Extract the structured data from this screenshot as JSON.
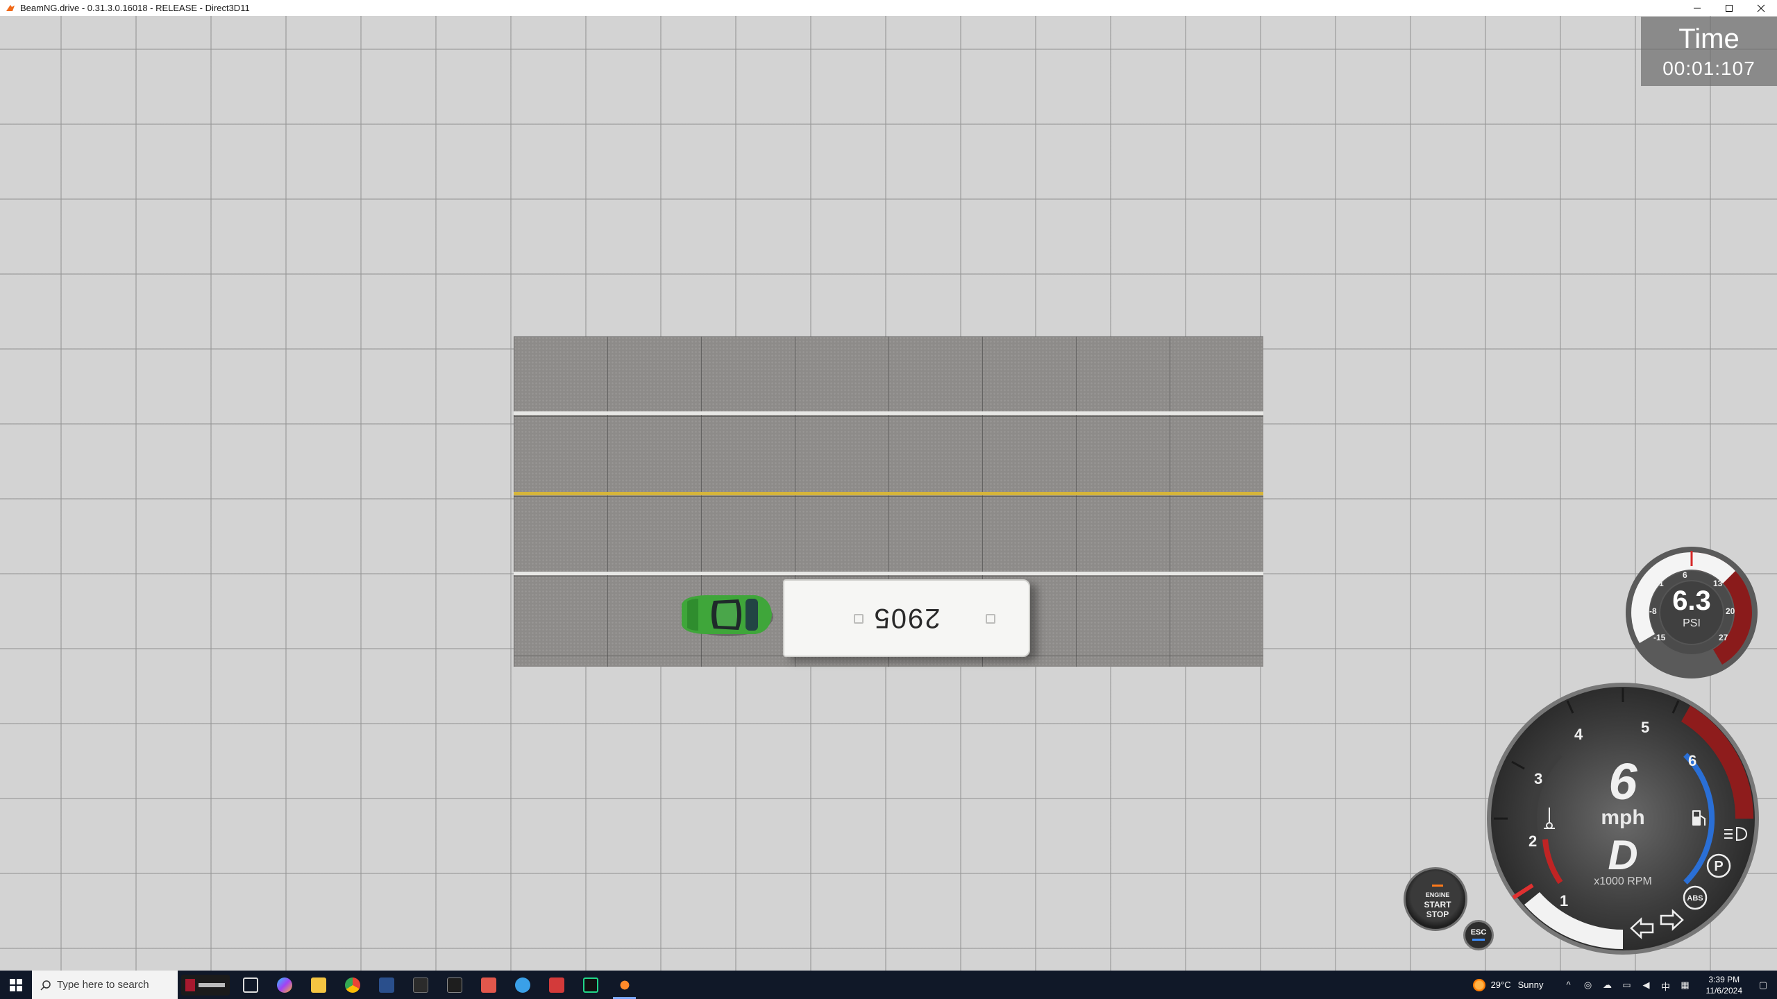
{
  "window": {
    "title": "BeamNG.drive - 0.31.3.0.16018 - RELEASE - Direct3D11",
    "controls": [
      "minimize-icon",
      "maximize-icon",
      "close-icon"
    ]
  },
  "scene": {
    "bus_number": "2905",
    "ground_color": "#d3d3d3",
    "road_color": "#8d8b89",
    "lane_line_white": "#e7e7e5",
    "lane_line_yellow": "#d6b53a",
    "car_color": "#3fa63a"
  },
  "hud": {
    "timer": {
      "label": "Time",
      "value": "00:01:107"
    },
    "boost": {
      "value": "6.3",
      "unit": "PSI",
      "ticks": [
        "-1",
        "6",
        "13",
        "-8",
        "20",
        "-15",
        "27"
      ]
    },
    "speedometer": {
      "speed": "6",
      "speed_unit": "mph",
      "gear": "D",
      "rpm_unit": "x1000 RPM",
      "rpm_labels": [
        "1",
        "2",
        "3",
        "4",
        "5",
        "6"
      ],
      "redline_color": "#8e1c1c",
      "fuel_color": "#2a6fd6",
      "temp_color": "#c02424"
    },
    "engine_button": {
      "line1": "ENGINE",
      "line2": "START",
      "line3": "STOP"
    },
    "esc_label": "ESC",
    "indicators": [
      "headlight-icon",
      "parking-brake-icon",
      "abs-icon",
      "left-turn-signal-icon",
      "right-turn-signal-icon"
    ]
  },
  "taskbar": {
    "search_placeholder": "Type here to search",
    "apps": [
      "macquarie-app",
      "task-view",
      "copilot",
      "file-explorer",
      "chrome",
      "powershell",
      "window-app",
      "terminal",
      "pdf-app",
      "browser-app",
      "media-app",
      "pycharm",
      "beamng"
    ],
    "weather": {
      "temp": "29°C",
      "condition": "Sunny"
    },
    "clock": {
      "time": "3:39 PM",
      "date": "11/6/2024"
    },
    "ime": "中"
  }
}
